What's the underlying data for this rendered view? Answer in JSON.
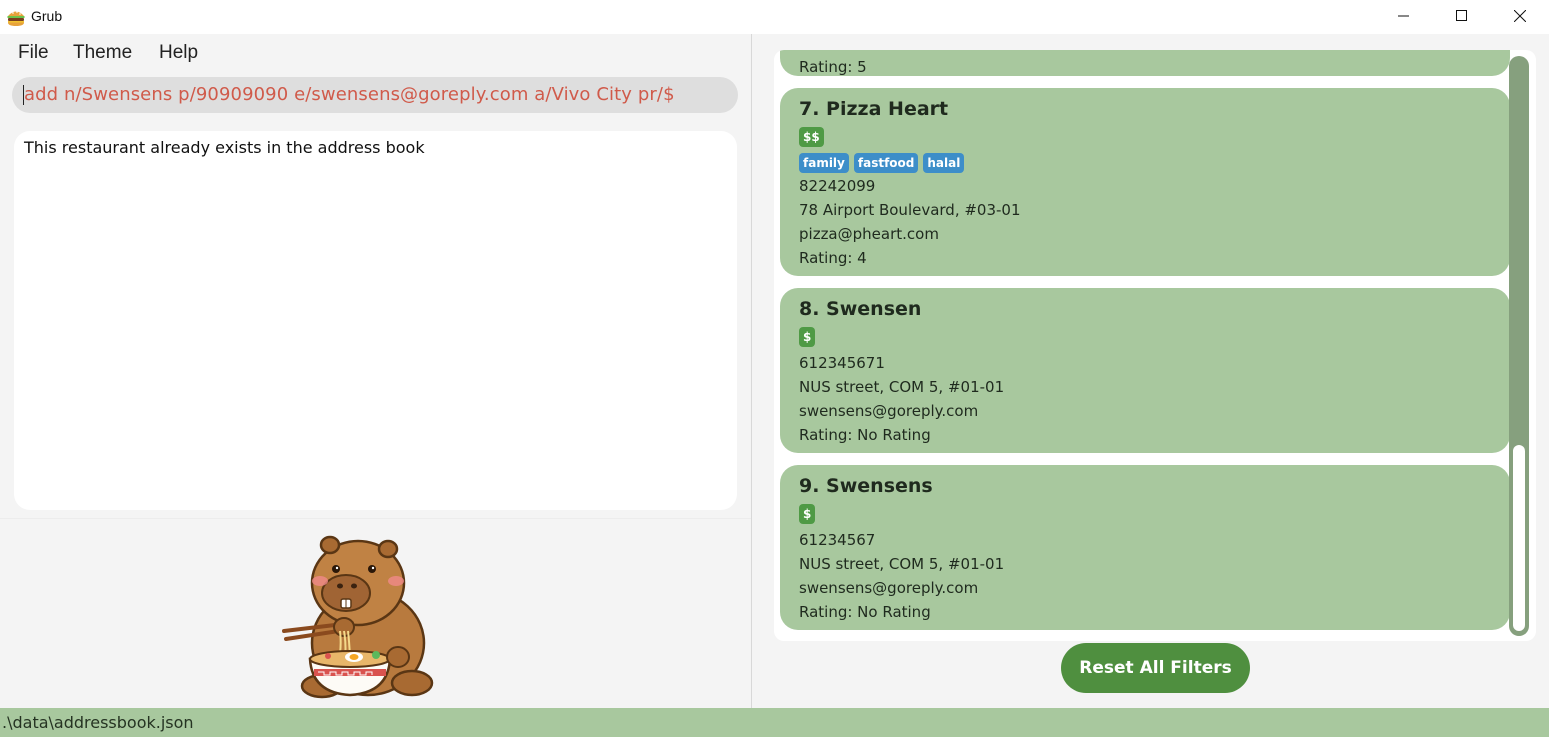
{
  "window": {
    "title": "Grub"
  },
  "menu": {
    "file": "File",
    "theme": "Theme",
    "help": "Help"
  },
  "command": {
    "value": "add n/Swensens p/90909090 e/swensens@goreply.com a/Vivo City pr/$"
  },
  "result": {
    "text": "This restaurant already exists in the address book"
  },
  "list": {
    "partial": {
      "rating": "Rating: 5"
    },
    "cards": [
      {
        "title": "7. Pizza Heart",
        "price": "$$",
        "tags": [
          "family",
          "fastfood",
          "halal"
        ],
        "phone": "82242099",
        "address": "78 Airport Boulevard, #03-01",
        "email": "pizza@pheart.com",
        "rating": "Rating: 4"
      },
      {
        "title": "8. Swensen",
        "price": "$",
        "tags": [],
        "phone": "612345671",
        "address": "NUS street, COM 5, #01-01",
        "email": "swensens@goreply.com",
        "rating": "Rating: No Rating"
      },
      {
        "title": "9. Swensens",
        "price": "$",
        "tags": [],
        "phone": "61234567",
        "address": "NUS street, COM 5, #01-01",
        "email": "swensens@goreply.com",
        "rating": "Rating: No Rating"
      }
    ]
  },
  "buttons": {
    "reset": "Reset All Filters"
  },
  "status": {
    "path": ".\\data\\addressbook.json"
  },
  "icons": {
    "app": "burger-icon",
    "minimize": "minimize-icon",
    "maximize": "maximize-icon",
    "close": "close-icon",
    "mascot": "capybara-ramen-mascot"
  },
  "colors": {
    "card": "#a8c89e",
    "price": "#4f9a45",
    "tag": "#3d8ec9",
    "command_text": "#d05a4a",
    "button": "#4f8f3f",
    "status_bar": "#a8c89e"
  }
}
